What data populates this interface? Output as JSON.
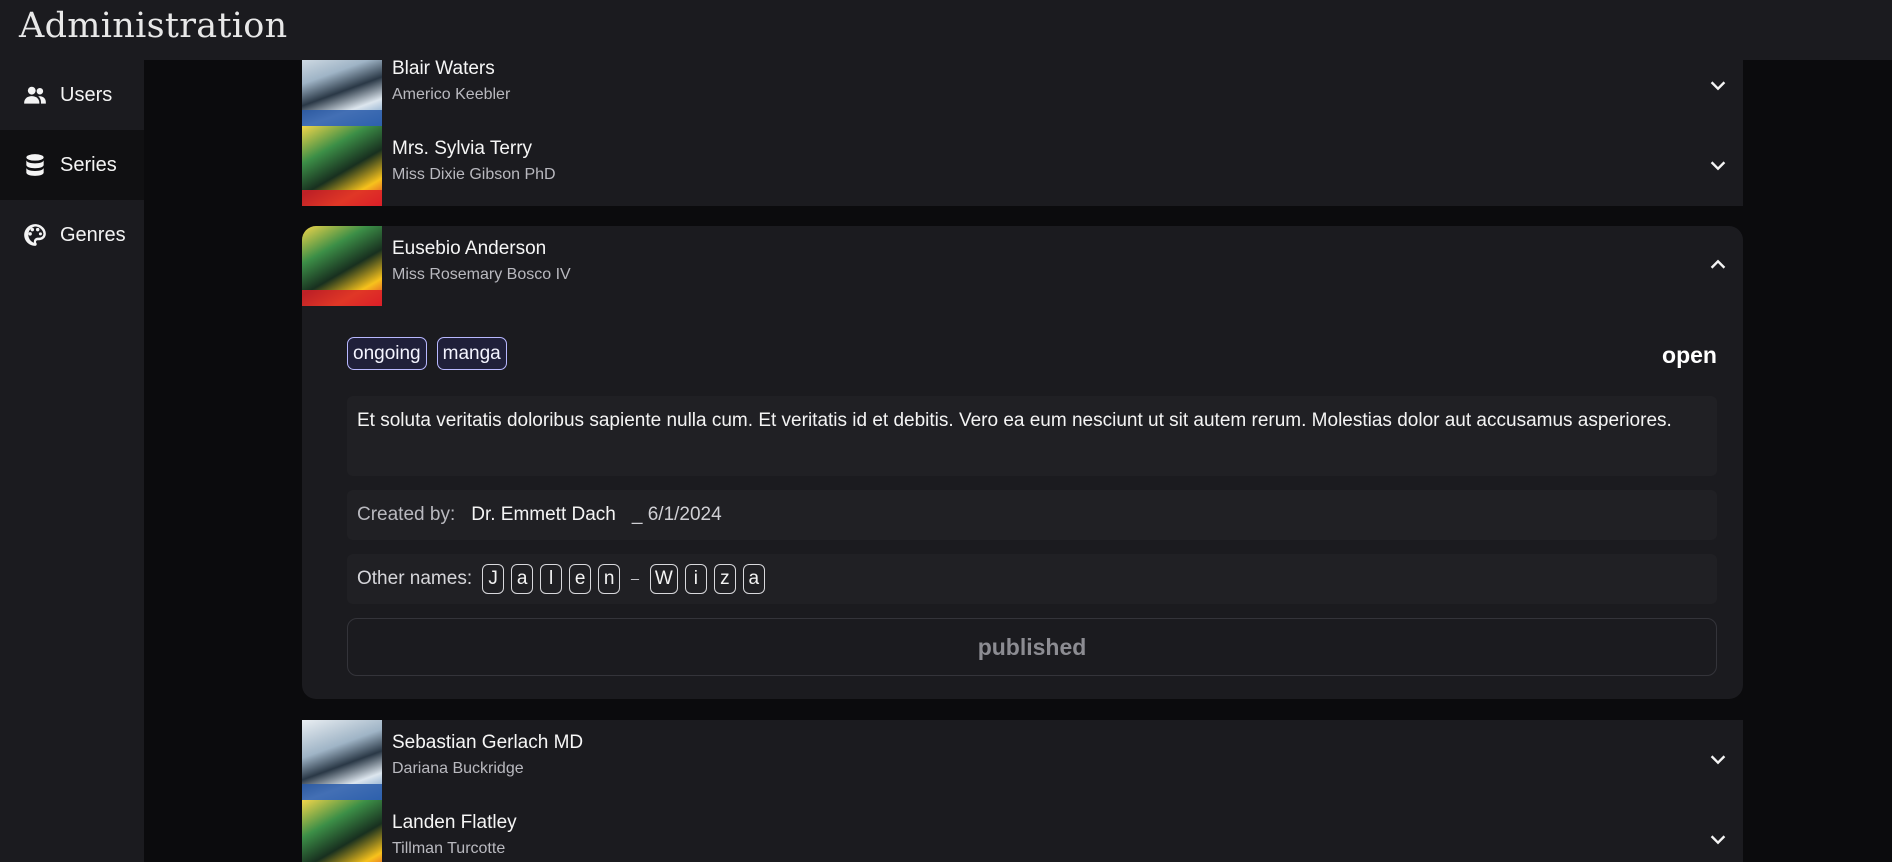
{
  "app": {
    "title": "Administration"
  },
  "sidebar": {
    "items": [
      {
        "label": "Users",
        "icon": "users-icon"
      },
      {
        "label": "Series",
        "icon": "database-icon",
        "active": true
      },
      {
        "label": "Genres",
        "icon": "palette-icon"
      }
    ]
  },
  "series": [
    {
      "name": "Blair Waters",
      "author": "Americo Keebler"
    },
    {
      "name": "Mrs. Sylvia Terry",
      "author": "Miss Dixie Gibson PhD"
    },
    {
      "name": "Eusebio Anderson",
      "author": "Miss Rosemary Bosco IV",
      "expanded": true,
      "tags": [
        "ongoing",
        "manga"
      ],
      "status": "open",
      "description": "Et soluta veritatis doloribus sapiente nulla cum. Et veritatis id et debitis. Vero ea eum nesciunt ut sit autem rerum. Molestias dolor aut accusamus asperiores.",
      "created_by_label": "Created by:",
      "created_by": "Dr. Emmett Dach",
      "created_date": "_ 6/1/2024",
      "other_names_label": "Other names:",
      "other_names_chars": [
        "J",
        "a",
        "l",
        "e",
        "n",
        "_",
        "W",
        "i",
        "z",
        "a"
      ],
      "publish_label": "published"
    },
    {
      "name": "Sebastian Gerlach MD",
      "author": "Dariana Buckridge"
    },
    {
      "name": "Landen Flatley",
      "author": "Tillman Turcotte"
    }
  ]
}
